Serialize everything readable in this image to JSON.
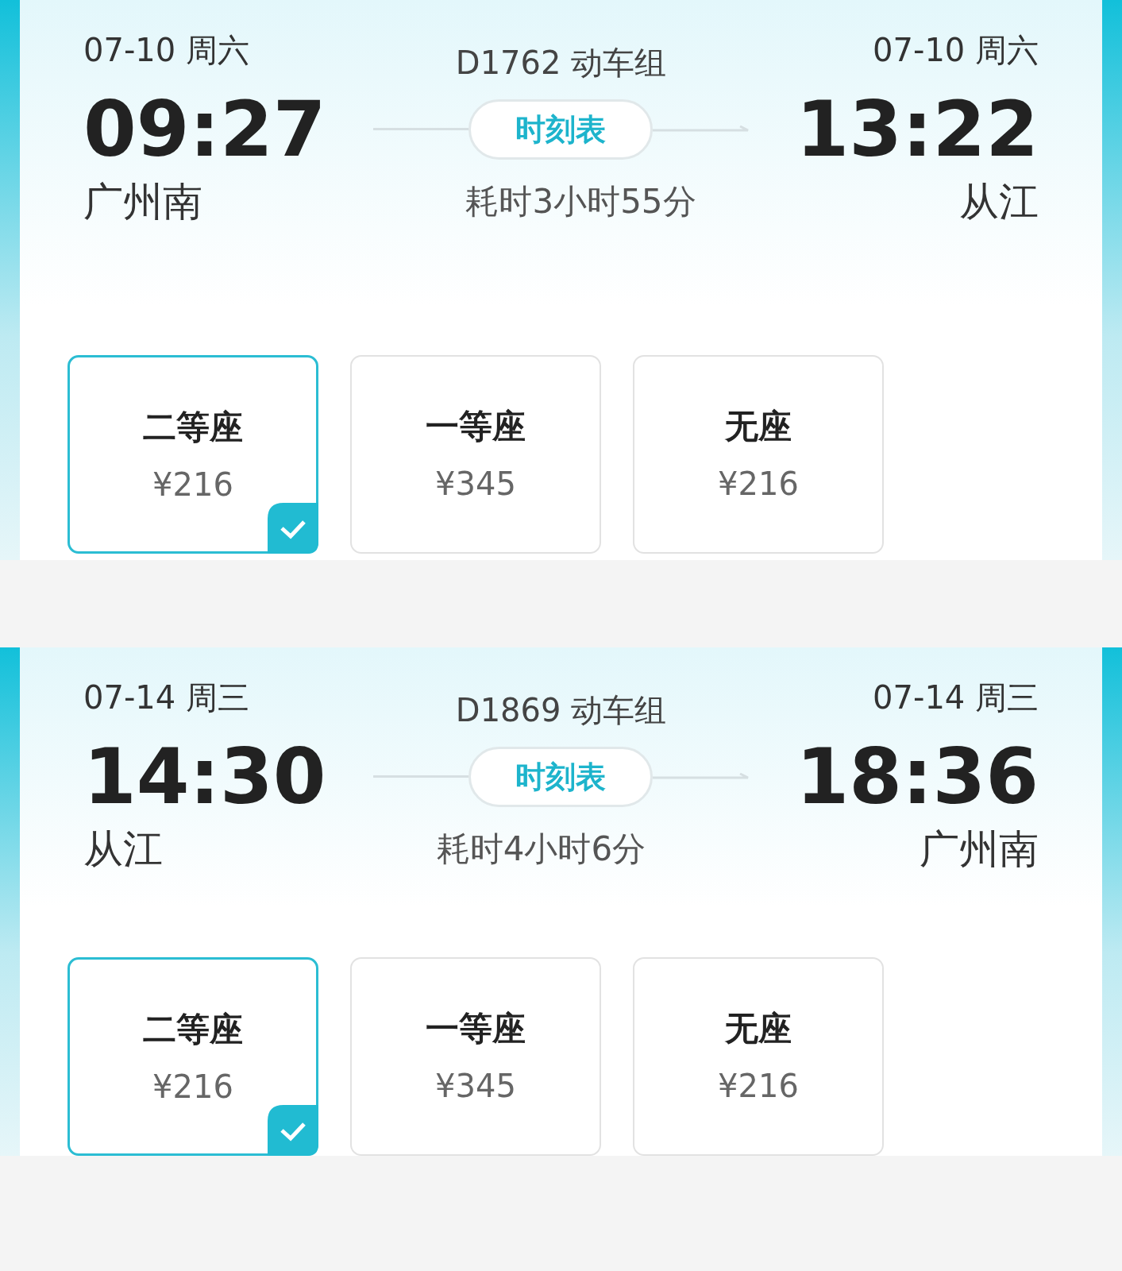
{
  "trips": [
    {
      "depart_date": "07-10 周六",
      "train": "D1762 动车组",
      "arrive_date": "07-10 周六",
      "depart_time": "09:27",
      "timetable_button": "时刻表",
      "arrive_time": "13:22",
      "from_station": "广州南",
      "duration": "耗时3小时55分",
      "to_station": "从江",
      "seats": [
        {
          "name": "二等座",
          "price": "¥216",
          "selected": true
        },
        {
          "name": "一等座",
          "price": "¥345",
          "selected": false
        },
        {
          "name": "无座",
          "price": "¥216",
          "selected": false
        }
      ]
    },
    {
      "depart_date": "07-14 周三",
      "train": "D1869 动车组",
      "arrive_date": "07-14 周三",
      "depart_time": "14:30",
      "timetable_button": "时刻表",
      "arrive_time": "18:36",
      "from_station": "从江",
      "duration": "耗时4小时6分",
      "to_station": "广州南",
      "seats": [
        {
          "name": "二等座",
          "price": "¥216",
          "selected": true
        },
        {
          "name": "一等座",
          "price": "¥345",
          "selected": false
        },
        {
          "name": "无座",
          "price": "¥216",
          "selected": false
        }
      ]
    }
  ]
}
